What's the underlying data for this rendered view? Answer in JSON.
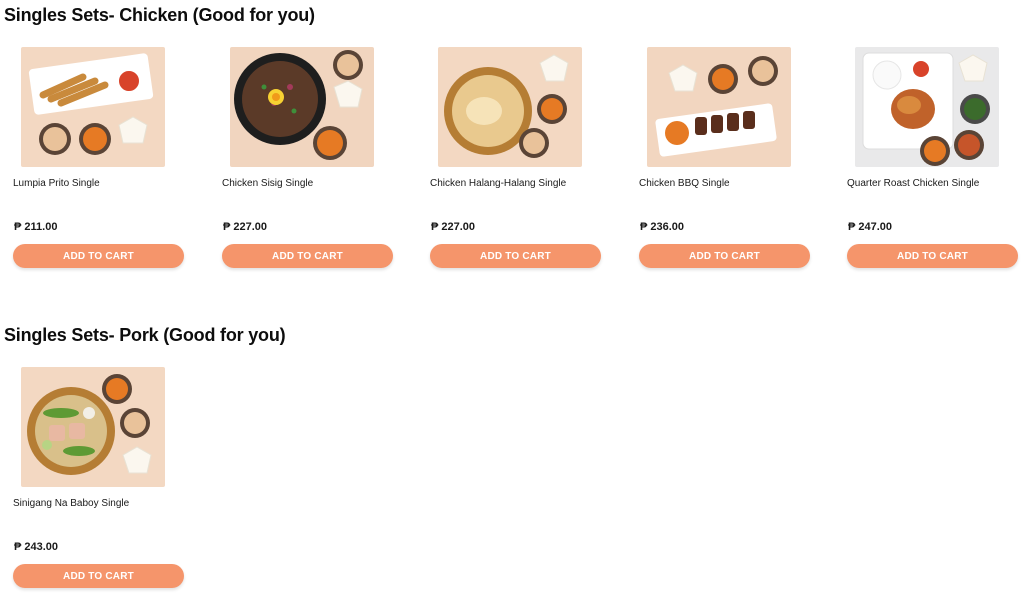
{
  "colors": {
    "accent": "#f5956b",
    "image_bg": "#f2d9c4"
  },
  "sections": [
    {
      "title": "Singles Sets- Chicken (Good for you)",
      "items": [
        {
          "name": "Lumpia Prito Single",
          "price": "₱ 211.00",
          "button": "ADD TO CART",
          "image": "lumpia-prito-photo"
        },
        {
          "name": "Chicken Sisig Single",
          "price": "₱ 227.00",
          "button": "ADD TO CART",
          "image": "chicken-sisig-photo"
        },
        {
          "name": "Chicken Halang-Halang Single",
          "price": "₱ 227.00",
          "button": "ADD TO CART",
          "image": "chicken-halang-halang-photo"
        },
        {
          "name": "Chicken BBQ Single",
          "price": "₱ 236.00",
          "button": "ADD TO CART",
          "image": "chicken-bbq-photo"
        },
        {
          "name": "Quarter Roast Chicken Single",
          "price": "₱ 247.00",
          "button": "ADD TO CART",
          "image": "quarter-roast-chicken-photo"
        }
      ]
    },
    {
      "title": "Singles Sets- Pork (Good for you)",
      "items": [
        {
          "name": "Sinigang Na Baboy Single",
          "price": "₱ 243.00",
          "button": "ADD TO CART",
          "image": "sinigang-na-baboy-photo"
        }
      ]
    }
  ]
}
